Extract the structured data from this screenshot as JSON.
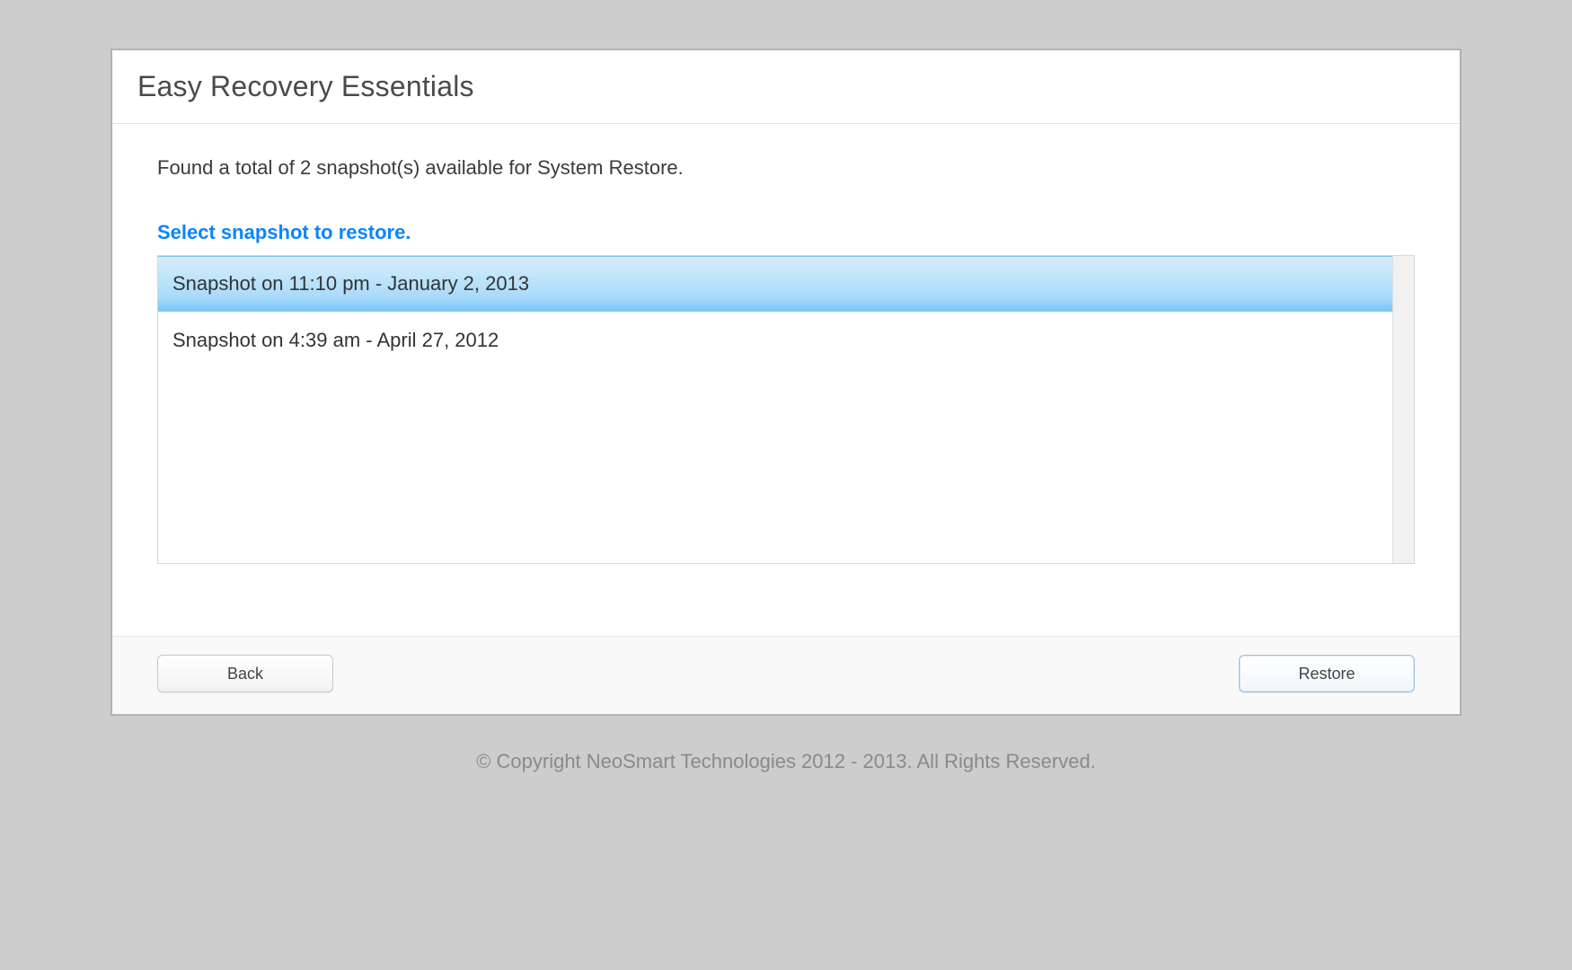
{
  "window": {
    "title": "Easy Recovery Essentials"
  },
  "main": {
    "status": "Found a total of 2 snapshot(s) available for System Restore.",
    "select_heading": "Select snapshot to restore.",
    "snapshots": [
      {
        "label": "Snapshot on 11:10 pm - January 2, 2013",
        "selected": true
      },
      {
        "label": "Snapshot on 4:39 am - April 27, 2012",
        "selected": false
      }
    ]
  },
  "footer": {
    "back_label": "Back",
    "restore_label": "Restore"
  },
  "copyright": "© Copyright NeoSmart Technologies 2012 - 2013. All Rights Reserved."
}
